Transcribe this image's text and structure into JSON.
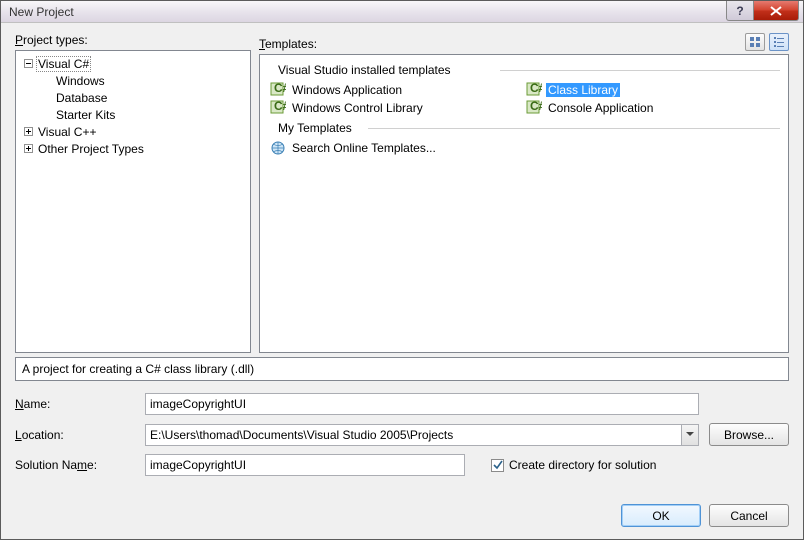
{
  "window": {
    "title": "New Project"
  },
  "panes": {
    "project_types_label": "Project types:",
    "templates_label": "Templates:"
  },
  "tree": {
    "csharp": "Visual C#",
    "csharp_children": [
      "Windows",
      "Database",
      "Starter Kits"
    ],
    "cpp": "Visual C++",
    "other": "Other Project Types"
  },
  "templates": {
    "group_installed": "Visual Studio installed templates",
    "group_my": "My Templates",
    "items_col1": [
      "Windows Application",
      "Windows Control Library"
    ],
    "items_col2": [
      "Class Library",
      "Console Application"
    ],
    "items_my": [
      "Search Online Templates..."
    ],
    "selected": "Class Library"
  },
  "description": "A project for creating a C# class library (.dll)",
  "form": {
    "name_label": "Name:",
    "name_value": "imageCopyrightUI",
    "location_label": "Location:",
    "location_value": "E:\\Users\\thomad\\Documents\\Visual Studio 2005\\Projects",
    "browse_label": "Browse...",
    "solution_label": "Solution Name:",
    "solution_value": "imageCopyrightUI",
    "create_dir_label": "Create directory for solution",
    "create_dir_checked": true
  },
  "buttons": {
    "ok": "OK",
    "cancel": "Cancel"
  }
}
